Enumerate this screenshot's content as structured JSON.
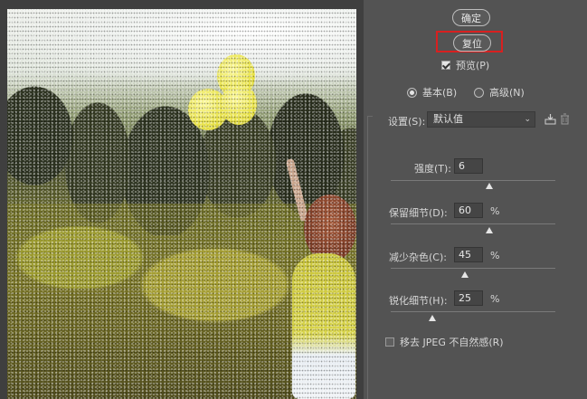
{
  "buttons": {
    "ok": "确定",
    "reset": "复位"
  },
  "preview_checkbox": {
    "label": "预览(P)",
    "checked": true
  },
  "mode": {
    "basic": "基本(B)",
    "advanced": "高级(N)",
    "selected": "basic"
  },
  "settings": {
    "label": "设置(S):",
    "value": "默认值"
  },
  "sliders": [
    {
      "label": "强度(T):",
      "value": "6",
      "unit": "",
      "level": 0.6
    },
    {
      "label": "保留细节(D):",
      "value": "60",
      "unit": "%",
      "level": 0.6
    },
    {
      "label": "减少杂色(C):",
      "value": "45",
      "unit": "%",
      "level": 0.45
    },
    {
      "label": "锐化细节(H):",
      "value": "25",
      "unit": "%",
      "level": 0.25
    }
  ],
  "jpeg_checkbox": {
    "label": "移去 JPEG 不自然感(R)",
    "checked": false
  },
  "icons": {
    "save": "save-settings-icon",
    "delete": "trash-icon",
    "dropdown": "chevron-down-icon"
  },
  "colors": {
    "panel_bg": "#535353",
    "highlight": "#d82020"
  }
}
